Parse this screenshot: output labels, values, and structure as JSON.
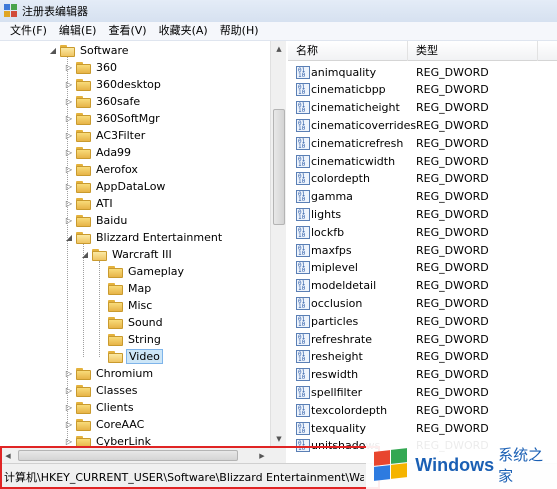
{
  "window": {
    "title": "注册表编辑器"
  },
  "menu": [
    "文件(F)",
    "编辑(E)",
    "查看(V)",
    "收藏夹(A)",
    "帮助(H)"
  ],
  "tree": [
    {
      "label": "Software",
      "depth": 0,
      "toggle": "◢",
      "open": true
    },
    {
      "label": "360",
      "depth": 1,
      "toggle": "▷"
    },
    {
      "label": "360desktop",
      "depth": 1,
      "toggle": "▷"
    },
    {
      "label": "360safe",
      "depth": 1,
      "toggle": "▷"
    },
    {
      "label": "360SoftMgr",
      "depth": 1,
      "toggle": "▷"
    },
    {
      "label": "AC3Filter",
      "depth": 1,
      "toggle": "▷"
    },
    {
      "label": "Ada99",
      "depth": 1,
      "toggle": "▷"
    },
    {
      "label": "Aerofox",
      "depth": 1,
      "toggle": "▷"
    },
    {
      "label": "AppDataLow",
      "depth": 1,
      "toggle": "▷"
    },
    {
      "label": "ATI",
      "depth": 1,
      "toggle": "▷"
    },
    {
      "label": "Baidu",
      "depth": 1,
      "toggle": "▷"
    },
    {
      "label": "Blizzard Entertainment",
      "depth": 1,
      "toggle": "◢",
      "open": true
    },
    {
      "label": "Warcraft III",
      "depth": 2,
      "toggle": "◢",
      "open": true
    },
    {
      "label": "Gameplay",
      "depth": 3,
      "toggle": ""
    },
    {
      "label": "Map",
      "depth": 3,
      "toggle": ""
    },
    {
      "label": "Misc",
      "depth": 3,
      "toggle": ""
    },
    {
      "label": "Sound",
      "depth": 3,
      "toggle": ""
    },
    {
      "label": "String",
      "depth": 3,
      "toggle": ""
    },
    {
      "label": "Video",
      "depth": 3,
      "toggle": "",
      "selected": true,
      "open": true
    },
    {
      "label": "Chromium",
      "depth": 1,
      "toggle": "▷"
    },
    {
      "label": "Classes",
      "depth": 1,
      "toggle": "▷"
    },
    {
      "label": "Clients",
      "depth": 1,
      "toggle": "▷"
    },
    {
      "label": "CoreAAC",
      "depth": 1,
      "toggle": "▷"
    },
    {
      "label": "CyberLink",
      "depth": 1,
      "toggle": "▷"
    }
  ],
  "list": {
    "columns": {
      "name": "名称",
      "type": "类型"
    },
    "rows": [
      {
        "name": "animquality",
        "type": "REG_DWORD"
      },
      {
        "name": "cinematicbpp",
        "type": "REG_DWORD"
      },
      {
        "name": "cinematicheight",
        "type": "REG_DWORD"
      },
      {
        "name": "cinematicoverrides",
        "type": "REG_DWORD"
      },
      {
        "name": "cinematicrefresh",
        "type": "REG_DWORD"
      },
      {
        "name": "cinematicwidth",
        "type": "REG_DWORD"
      },
      {
        "name": "colordepth",
        "type": "REG_DWORD"
      },
      {
        "name": "gamma",
        "type": "REG_DWORD"
      },
      {
        "name": "lights",
        "type": "REG_DWORD"
      },
      {
        "name": "lockfb",
        "type": "REG_DWORD"
      },
      {
        "name": "maxfps",
        "type": "REG_DWORD"
      },
      {
        "name": "miplevel",
        "type": "REG_DWORD"
      },
      {
        "name": "modeldetail",
        "type": "REG_DWORD"
      },
      {
        "name": "occlusion",
        "type": "REG_DWORD"
      },
      {
        "name": "particles",
        "type": "REG_DWORD"
      },
      {
        "name": "refreshrate",
        "type": "REG_DWORD"
      },
      {
        "name": "resheight",
        "type": "REG_DWORD"
      },
      {
        "name": "reswidth",
        "type": "REG_DWORD"
      },
      {
        "name": "spellfilter",
        "type": "REG_DWORD"
      },
      {
        "name": "texcolordepth",
        "type": "REG_DWORD"
      },
      {
        "name": "texquality",
        "type": "REG_DWORD"
      },
      {
        "name": "unitshadows",
        "type": "REG_DWORD"
      }
    ]
  },
  "statusbar": {
    "path": "计算机\\HKEY_CURRENT_USER\\Software\\Blizzard Entertainment\\Warcraft III\\Video"
  },
  "watermark": {
    "brand": "Windows",
    "sub": "系统之家"
  },
  "colors": {
    "selection": "#cde6f7",
    "highlight_box": "#e02424",
    "watermark": "#1a5fb4"
  }
}
